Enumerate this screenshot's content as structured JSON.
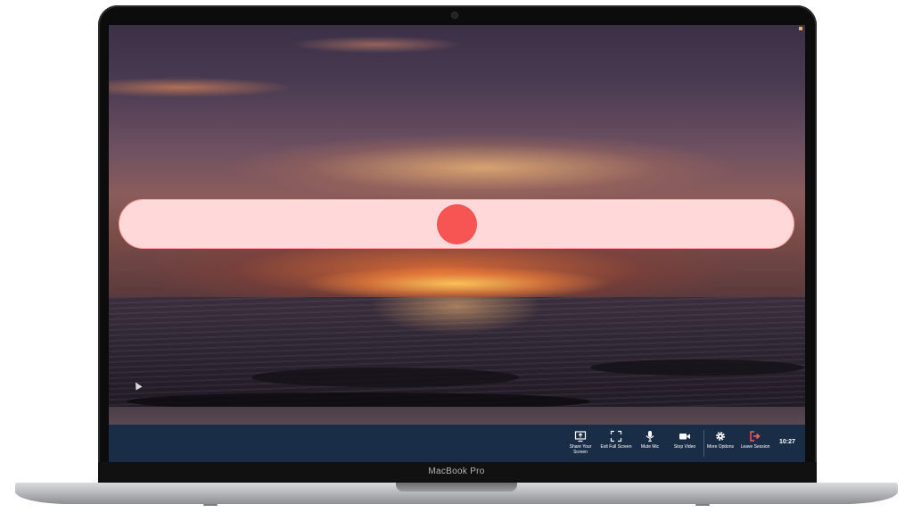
{
  "device": {
    "brand_label": "MacBook Pro"
  },
  "slider": {
    "accent_track": "#ffd9d9",
    "accent_thumb": "#f75454",
    "thumb_position_fraction": 0.5
  },
  "toolbar": {
    "background": "#1a2d47",
    "buttons": [
      {
        "icon": "share-screen-icon",
        "label": "Share Your Screen"
      },
      {
        "icon": "exit-fullscreen-icon",
        "label": "Exit Full Screen"
      },
      {
        "icon": "microphone-icon",
        "label": "Mute Mic"
      },
      {
        "icon": "video-camera-icon",
        "label": "Stop Video"
      },
      {
        "icon": "gear-icon",
        "label": "More Options"
      },
      {
        "icon": "leave-session-icon",
        "label": "Leave Session"
      }
    ],
    "clock": "10:27"
  }
}
